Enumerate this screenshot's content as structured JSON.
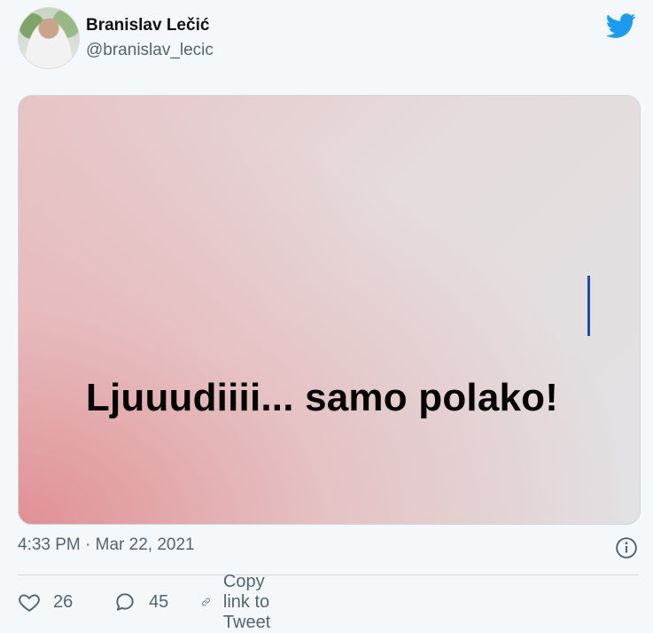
{
  "author": {
    "display_name": "Branislav Lečić",
    "handle": "@branislav_lecic"
  },
  "media": {
    "caption_text": "Ljuuudiiii... samo polako!"
  },
  "meta": {
    "timestamp": "4:33 PM · Mar 22, 2021"
  },
  "actions": {
    "likes": "26",
    "replies": "45",
    "copy_link_label": "Copy link to Tweet"
  },
  "colors": {
    "twitter_blue": "#1d9bf0",
    "text_gray": "#536471",
    "cursor_blue": "#1e4ea7"
  },
  "icons": [
    "twitter-bird-icon",
    "info-icon",
    "heart-icon",
    "reply-bubble-icon",
    "link-icon"
  ]
}
